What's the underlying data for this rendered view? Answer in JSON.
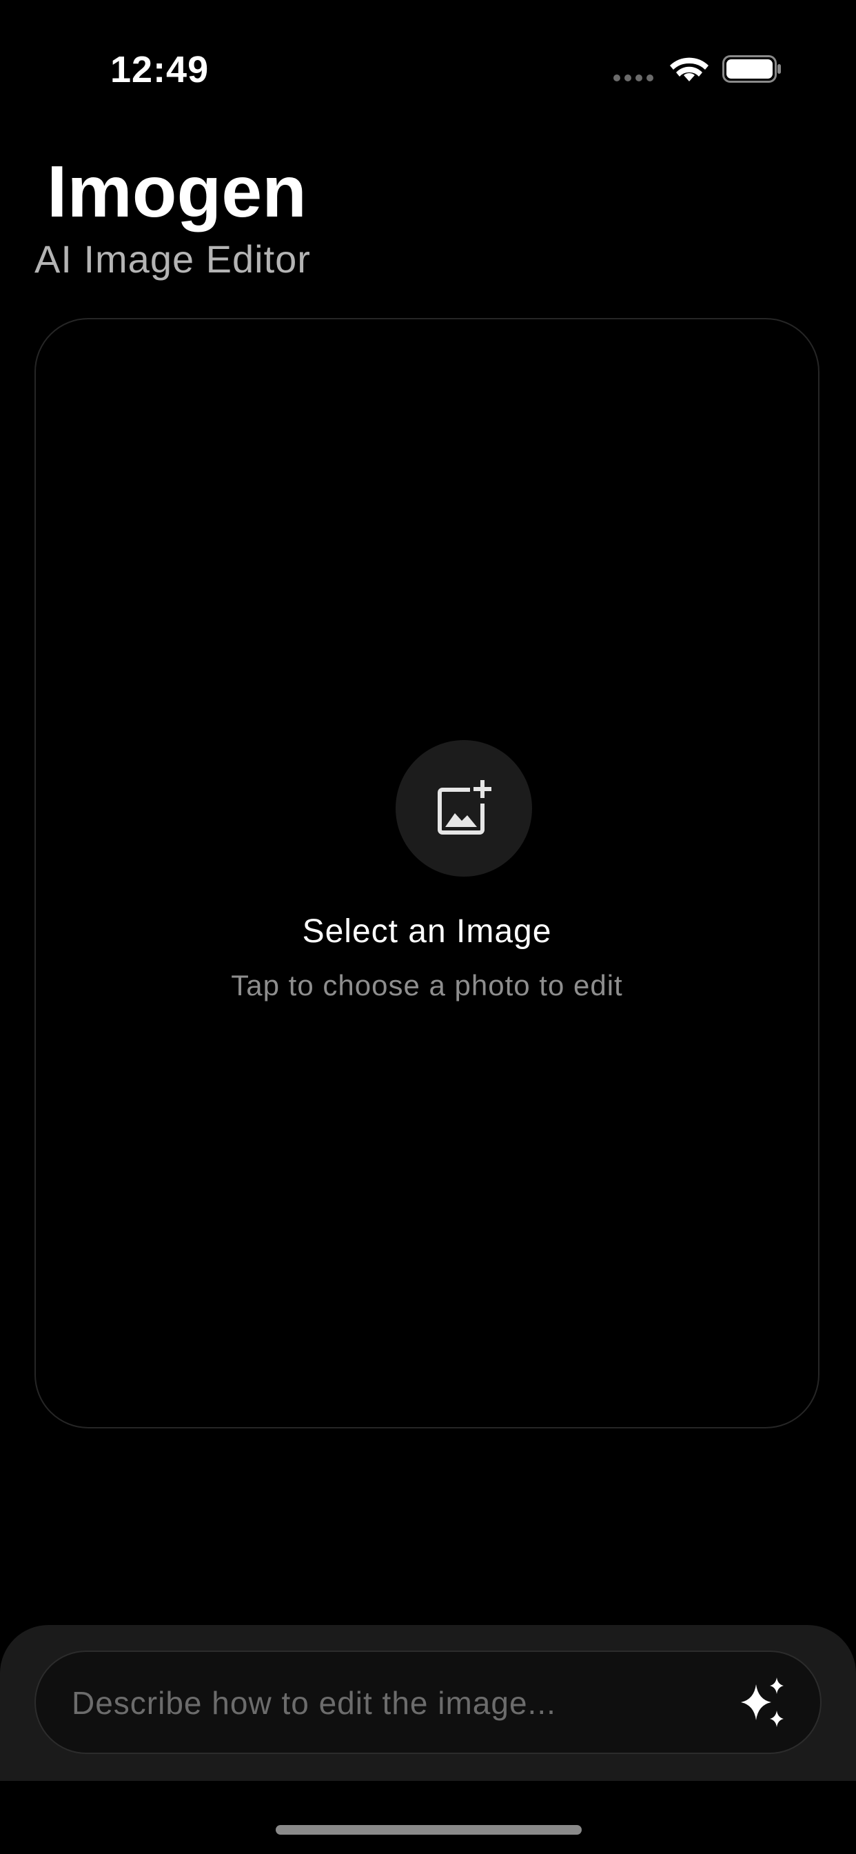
{
  "status_bar": {
    "time": "12:49",
    "icons": [
      "cellular-dots-icon",
      "wifi-icon",
      "battery-icon"
    ]
  },
  "header": {
    "title": "Imogen",
    "subtitle": "AI Image Editor"
  },
  "image_picker": {
    "icon": "add-photo-icon",
    "title": "Select an Image",
    "hint": "Tap to choose a photo to edit"
  },
  "prompt": {
    "value": "",
    "placeholder": "Describe how to edit the image...",
    "submit_icon": "sparkles-icon"
  },
  "colors": {
    "background": "#000000",
    "panel": "#1b1b1b",
    "text_primary": "#ffffff",
    "text_secondary": "#8e8e8e"
  }
}
